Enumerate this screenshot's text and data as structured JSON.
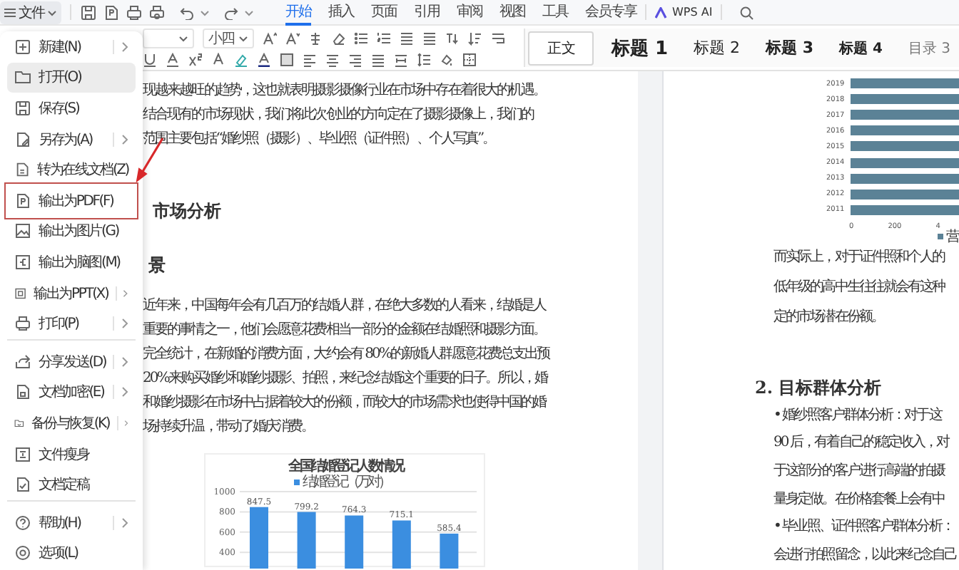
{
  "menu_bar": {
    "file_button": {
      "label": "文件",
      "expanded": true
    },
    "tabs": [
      {
        "label": "开始",
        "selected": true
      },
      {
        "label": "插入",
        "selected": false
      },
      {
        "label": "页面",
        "selected": false
      },
      {
        "label": "引用",
        "selected": false
      },
      {
        "label": "审阅",
        "selected": false
      },
      {
        "label": "视图",
        "selected": false
      },
      {
        "label": "工具",
        "selected": false
      },
      {
        "label": "会员专享",
        "selected": false
      }
    ],
    "ai_button": {
      "label": "WPS AI"
    }
  },
  "ribbon": {
    "font_size": {
      "value": "小四"
    },
    "styles": [
      {
        "label": "正文",
        "kind": "body",
        "selected": true
      },
      {
        "label": "标题 1",
        "kind": "h1",
        "selected": false
      },
      {
        "label": "标题 2",
        "kind": "h2",
        "selected": false
      },
      {
        "label": "标题 3",
        "kind": "h3",
        "selected": false
      },
      {
        "label": "标题 4",
        "kind": "h4",
        "selected": false
      },
      {
        "label": "目录 3",
        "kind": "toc",
        "selected": false
      }
    ]
  },
  "file_menu": {
    "items": [
      {
        "label": "新建(N)",
        "has_submenu": true,
        "highlighted": false,
        "marked": false,
        "separator_before": false
      },
      {
        "label": "打开(O)",
        "has_submenu": false,
        "highlighted": true,
        "marked": false,
        "separator_before": false
      },
      {
        "label": "保存(S)",
        "has_submenu": false,
        "highlighted": false,
        "marked": false,
        "separator_before": false
      },
      {
        "label": "另存为(A)",
        "has_submenu": true,
        "highlighted": false,
        "marked": false,
        "separator_before": false
      },
      {
        "label": "转为在线文档(Z)",
        "has_submenu": false,
        "highlighted": false,
        "marked": false,
        "separator_before": false
      },
      {
        "label": "输出为PDF(F)",
        "has_submenu": false,
        "highlighted": false,
        "marked": true,
        "separator_before": false
      },
      {
        "label": "输出为图片(G)",
        "has_submenu": false,
        "highlighted": false,
        "marked": false,
        "separator_before": false
      },
      {
        "label": "输出为脑图(M)",
        "has_submenu": false,
        "highlighted": false,
        "marked": false,
        "separator_before": false
      },
      {
        "label": "输出为PPT(X)",
        "has_submenu": true,
        "highlighted": false,
        "marked": false,
        "separator_before": false
      },
      {
        "label": "打印(P)",
        "has_submenu": true,
        "highlighted": false,
        "marked": false,
        "separator_before": false
      },
      {
        "label": "分享发送(D)",
        "has_submenu": true,
        "highlighted": false,
        "marked": false,
        "separator_before": true
      },
      {
        "label": "文档加密(E)",
        "has_submenu": true,
        "highlighted": false,
        "marked": false,
        "separator_before": false
      },
      {
        "label": "备份与恢复(K)",
        "has_submenu": true,
        "highlighted": false,
        "marked": false,
        "separator_before": false
      },
      {
        "label": "文件瘦身",
        "has_submenu": false,
        "highlighted": false,
        "marked": false,
        "separator_before": false
      },
      {
        "label": "文档定稿",
        "has_submenu": false,
        "highlighted": false,
        "marked": false,
        "separator_before": false
      },
      {
        "label": "帮助(H)",
        "has_submenu": true,
        "highlighted": false,
        "marked": false,
        "separator_before": true
      },
      {
        "label": "选项(L)",
        "has_submenu": false,
        "highlighted": false,
        "marked": false,
        "separator_before": false
      }
    ]
  },
  "document": {
    "left_page": {
      "blocks": [
        {
          "kind": "paragraph",
          "lines": [
            "现越来越旺的趋势，这也就表明摄影摄像行业在市场中存在着很大的机遇。",
            "结合现有的市场现状，我们将此次创业的方向定在了摄影摄像上，我们的",
            "范围主要包括“婚纱照（摄影）、毕业照（证件照）、个人写真”。"
          ]
        },
        {
          "kind": "heading",
          "text": "市场分析"
        },
        {
          "kind": "subheading",
          "text": "景"
        },
        {
          "kind": "paragraph",
          "lines": [
            "近年来，中国每年会有几百万的结婚人群，在绝大多数的人看来，结婚是人",
            "重要的事情之一，他们会愿意花费相当一部分的金额在结婚照和摄影方面。",
            "完全统计，在新婚的消费方面，大约会有 80%的新婚人群愿意花费总支出预",
            "20%来购买婚纱和婚纱摄影、拍照，来纪念结婚这个重要的日子。所以，婚",
            "和婚纱摄影在市场中占据着较大的份额，而较大的市场需求也使得中国的婚",
            "场持续升温，带动了婚庆消费。"
          ]
        },
        {
          "kind": "chart",
          "chart_data": {
            "type": "bar",
            "title": "全国结婚登记人数情况",
            "series": [
              {
                "name": "结婚登记（万对）",
                "color": "#3b8ee0",
                "values": [
                  847.5,
                  799.2,
                  764.3,
                  715.1,
                  585.4
                ]
              }
            ],
            "ylim": [
              240,
              1000
            ],
            "grid": true,
            "yticks": [
              400,
              600,
              800,
              1000
            ],
            "data_labels": true
          }
        }
      ]
    },
    "right_page": {
      "chart": {
        "year_labels": [
          "2019",
          "2018",
          "2017",
          "2016",
          "2015",
          "2014",
          "2013",
          "2012",
          "2011"
        ],
        "tick_labels": [
          "0",
          "200",
          "4"
        ],
        "legend_label": "营"
      },
      "blocks": [
        {
          "kind": "paragraph",
          "lines": [
            "而实际上，对于证件照和个人的",
            "低年级的高中生往往就会有这种",
            "定的市场潜在份额。"
          ]
        },
        {
          "kind": "heading",
          "text": "2. 目标群体分析"
        },
        {
          "kind": "paragraph",
          "lines": [
            "• 婚纱照客户群体分析：对于这",
            "90 后，有着自己的稳定收入，对",
            "于这部分的客户进行高端的拍摄",
            "量身定做。在价格套餐上会有中",
            "• 毕业照、证件照客户群体分析：",
            "会进行拍照留念，以此来纪念自己"
          ]
        }
      ]
    }
  }
}
